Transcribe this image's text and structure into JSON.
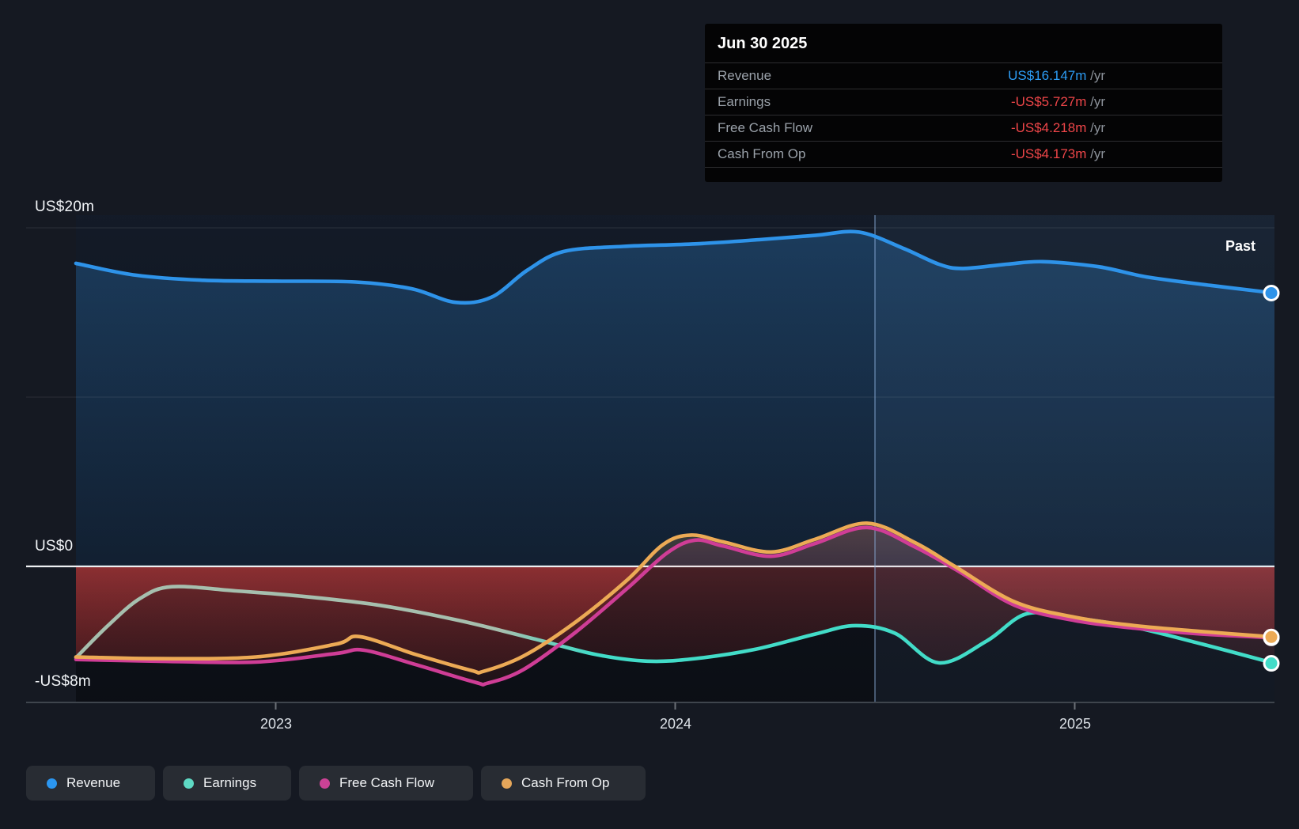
{
  "tooltip": {
    "date": "Jun 30 2025",
    "rows": [
      {
        "label": "Revenue",
        "value": "US$16.147m",
        "unit": " /yr",
        "color": "#2d9cf4"
      },
      {
        "label": "Earnings",
        "value": "-US$5.727m",
        "unit": " /yr",
        "color": "#ef4649"
      },
      {
        "label": "Free Cash Flow",
        "value": "-US$4.218m",
        "unit": " /yr",
        "color": "#ef4649"
      },
      {
        "label": "Cash From Op",
        "value": "-US$4.173m",
        "unit": " /yr",
        "color": "#ef4649"
      }
    ]
  },
  "axis": {
    "y_labels": [
      {
        "text": "US$20m",
        "value": 20
      },
      {
        "text": "US$0",
        "value": 0
      },
      {
        "text": "-US$8m",
        "value": -8
      }
    ],
    "x_labels": [
      {
        "text": "2023",
        "year": 2023
      },
      {
        "text": "2024",
        "year": 2024
      },
      {
        "text": "2025",
        "year": 2025
      }
    ],
    "past_label": "Past"
  },
  "legend": [
    {
      "label": "Revenue",
      "color": "#2b96f0"
    },
    {
      "label": "Earnings",
      "color": "#5ed9c4"
    },
    {
      "label": "Free Cash Flow",
      "color": "#cb4295"
    },
    {
      "label": "Cash From Op",
      "color": "#e5a65a"
    }
  ],
  "chart_data": {
    "type": "line",
    "title": "Earnings and Revenue History",
    "x_unit": "year (decimal)",
    "y_unit": "US$ millions per year",
    "x_range": [
      2022.5,
      2025.5
    ],
    "ylim": [
      -8,
      20
    ],
    "y_gridlines": [
      20,
      10,
      0,
      -8
    ],
    "x_ticks": [
      2023,
      2024,
      2025
    ],
    "crosshair_x": 2024.5,
    "highlight_from_x": 2024.5,
    "legend_position": "bottom",
    "end_marker_date": "Jun 30 2025",
    "series": [
      {
        "name": "Earnings",
        "color": "#42dcc8",
        "color_start": "#a6bfae",
        "fill": "negative-red",
        "end_value": -5.727,
        "points": [
          [
            2022.5,
            -5.4
          ],
          [
            2022.58,
            -3.5
          ],
          [
            2022.66,
            -1.9
          ],
          [
            2022.74,
            -1.2
          ],
          [
            2022.9,
            -1.45
          ],
          [
            2023.06,
            -1.75
          ],
          [
            2023.26,
            -2.3
          ],
          [
            2023.46,
            -3.2
          ],
          [
            2023.65,
            -4.3
          ],
          [
            2023.8,
            -5.2
          ],
          [
            2023.93,
            -5.6
          ],
          [
            2024.05,
            -5.45
          ],
          [
            2024.2,
            -4.9
          ],
          [
            2024.35,
            -4.0
          ],
          [
            2024.45,
            -3.5
          ],
          [
            2024.55,
            -3.95
          ],
          [
            2024.66,
            -5.7
          ],
          [
            2024.78,
            -4.4
          ],
          [
            2024.88,
            -2.8
          ],
          [
            2025.0,
            -3.05
          ],
          [
            2025.15,
            -3.6
          ],
          [
            2025.32,
            -4.6
          ],
          [
            2025.5,
            -5.727
          ]
        ]
      },
      {
        "name": "Free Cash Flow",
        "color": "#cf3d96",
        "fill": "negative-red positive-tint",
        "end_value": -4.218,
        "points": [
          [
            2022.5,
            -5.5
          ],
          [
            2022.7,
            -5.6
          ],
          [
            2022.95,
            -5.65
          ],
          [
            2023.15,
            -5.15
          ],
          [
            2023.22,
            -4.95
          ],
          [
            2023.35,
            -5.8
          ],
          [
            2023.5,
            -6.85
          ],
          [
            2023.53,
            -6.9
          ],
          [
            2023.62,
            -6.1
          ],
          [
            2023.75,
            -3.9
          ],
          [
            2023.88,
            -1.3
          ],
          [
            2023.98,
            0.8
          ],
          [
            2024.05,
            1.55
          ],
          [
            2024.12,
            1.2
          ],
          [
            2024.24,
            0.6
          ],
          [
            2024.35,
            1.35
          ],
          [
            2024.48,
            2.3
          ],
          [
            2024.6,
            1.15
          ],
          [
            2024.71,
            -0.3
          ],
          [
            2024.85,
            -2.3
          ],
          [
            2025.0,
            -3.2
          ],
          [
            2025.15,
            -3.65
          ],
          [
            2025.32,
            -4.0
          ],
          [
            2025.5,
            -4.218
          ]
        ]
      },
      {
        "name": "Cash From Op",
        "color": "#ecaa55",
        "fill": "negative-red positive-tint",
        "end_value": -4.173,
        "points": [
          [
            2022.5,
            -5.35
          ],
          [
            2022.7,
            -5.45
          ],
          [
            2022.95,
            -5.35
          ],
          [
            2023.15,
            -4.6
          ],
          [
            2023.21,
            -4.15
          ],
          [
            2023.35,
            -5.2
          ],
          [
            2023.49,
            -6.15
          ],
          [
            2023.52,
            -6.2
          ],
          [
            2023.62,
            -5.3
          ],
          [
            2023.75,
            -3.3
          ],
          [
            2023.88,
            -0.8
          ],
          [
            2023.97,
            1.3
          ],
          [
            2024.04,
            1.85
          ],
          [
            2024.12,
            1.45
          ],
          [
            2024.24,
            0.85
          ],
          [
            2024.35,
            1.6
          ],
          [
            2024.48,
            2.55
          ],
          [
            2024.6,
            1.4
          ],
          [
            2024.7,
            0.0
          ],
          [
            2024.85,
            -2.1
          ],
          [
            2025.0,
            -3.0
          ],
          [
            2025.15,
            -3.5
          ],
          [
            2025.32,
            -3.85
          ],
          [
            2025.5,
            -4.173
          ]
        ]
      },
      {
        "name": "Revenue",
        "color": "#2e93e9",
        "fill": "positive-blue",
        "end_value": 16.147,
        "points": [
          [
            2022.5,
            17.9
          ],
          [
            2022.65,
            17.2
          ],
          [
            2022.82,
            16.9
          ],
          [
            2023.0,
            16.85
          ],
          [
            2023.2,
            16.8
          ],
          [
            2023.34,
            16.4
          ],
          [
            2023.45,
            15.6
          ],
          [
            2023.54,
            15.9
          ],
          [
            2023.63,
            17.5
          ],
          [
            2023.72,
            18.6
          ],
          [
            2023.87,
            18.9
          ],
          [
            2024.05,
            19.05
          ],
          [
            2024.21,
            19.3
          ],
          [
            2024.35,
            19.55
          ],
          [
            2024.46,
            19.75
          ],
          [
            2024.57,
            18.8
          ],
          [
            2024.66,
            17.85
          ],
          [
            2024.72,
            17.6
          ],
          [
            2024.83,
            17.85
          ],
          [
            2024.92,
            18.0
          ],
          [
            2025.06,
            17.7
          ],
          [
            2025.18,
            17.1
          ],
          [
            2025.34,
            16.6
          ],
          [
            2025.5,
            16.147
          ]
        ]
      }
    ]
  }
}
